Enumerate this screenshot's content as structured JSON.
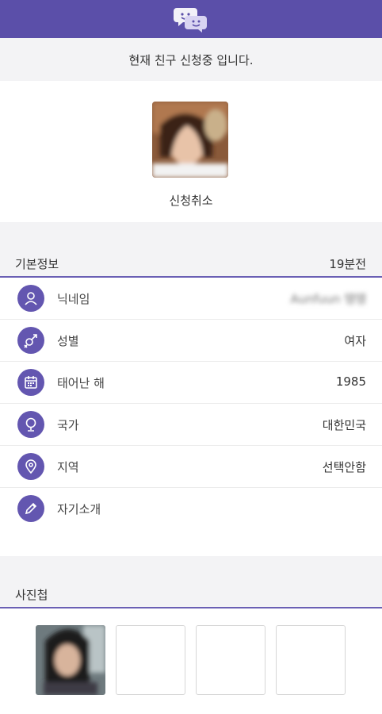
{
  "header": {
    "logo_icon": "chat-bubbles-icon"
  },
  "status_message": "현재 친구 신청중 입니다.",
  "profile": {
    "cancel_label": "신청취소"
  },
  "basic_info": {
    "title": "기본정보",
    "updated": "19분전",
    "rows": [
      {
        "icon": "person-icon",
        "label": "닉네임",
        "value": "Aunfuun 땡땡"
      },
      {
        "icon": "gender-icon",
        "label": "성별",
        "value": "여자"
      },
      {
        "icon": "calendar-icon",
        "label": "태어난 해",
        "value": "1985"
      },
      {
        "icon": "globe-icon",
        "label": "국가",
        "value": "대한민국"
      },
      {
        "icon": "location-pin-icon",
        "label": "지역",
        "value": "선택안함"
      },
      {
        "icon": "pencil-icon",
        "label": "자기소개",
        "value": ""
      }
    ]
  },
  "album": {
    "title": "사진첩"
  },
  "colors": {
    "primary": "#5b4fa9",
    "icon_bg": "#6356b0",
    "section_bg": "#f3f3f5"
  }
}
